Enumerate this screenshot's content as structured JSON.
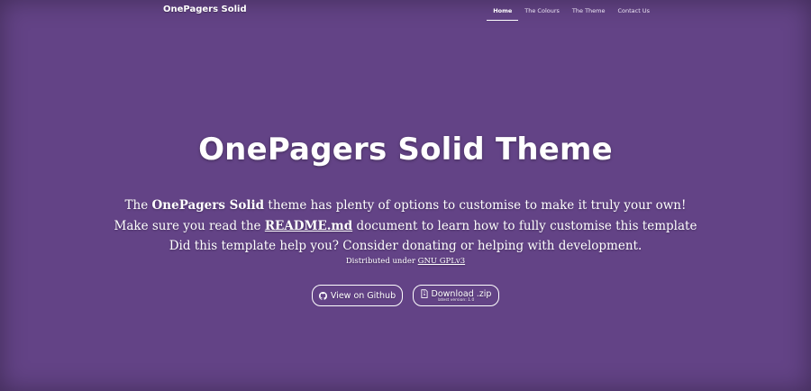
{
  "nav": {
    "brand": "OnePagers Solid",
    "items": [
      {
        "label": "Home",
        "active": true
      },
      {
        "label": "The Colours",
        "active": false
      },
      {
        "label": "The Theme",
        "active": false
      },
      {
        "label": "Contact Us",
        "active": false
      }
    ]
  },
  "hero": {
    "title": "OnePagers Solid Theme",
    "line1": {
      "pre": "The ",
      "bold": "OnePagers Solid",
      "post": " theme has plenty of options to customise to make it truly your own!"
    },
    "line2": {
      "pre": "Make sure you read the ",
      "link": "README.md",
      "post": " document to learn how to fully customise this template"
    },
    "line3": "Did this template help you? Consider donating or helping with development.",
    "license": {
      "pre": "Distributed under ",
      "link": "GNU GPLv3"
    }
  },
  "buttons": {
    "github": {
      "label": "View on Github",
      "icon": "github-icon"
    },
    "download": {
      "label": "Download .zip",
      "sublabel": "latest version: 1.0",
      "icon": "file-zip-icon"
    }
  },
  "colors": {
    "background": "#634386",
    "text": "#ffffff"
  }
}
